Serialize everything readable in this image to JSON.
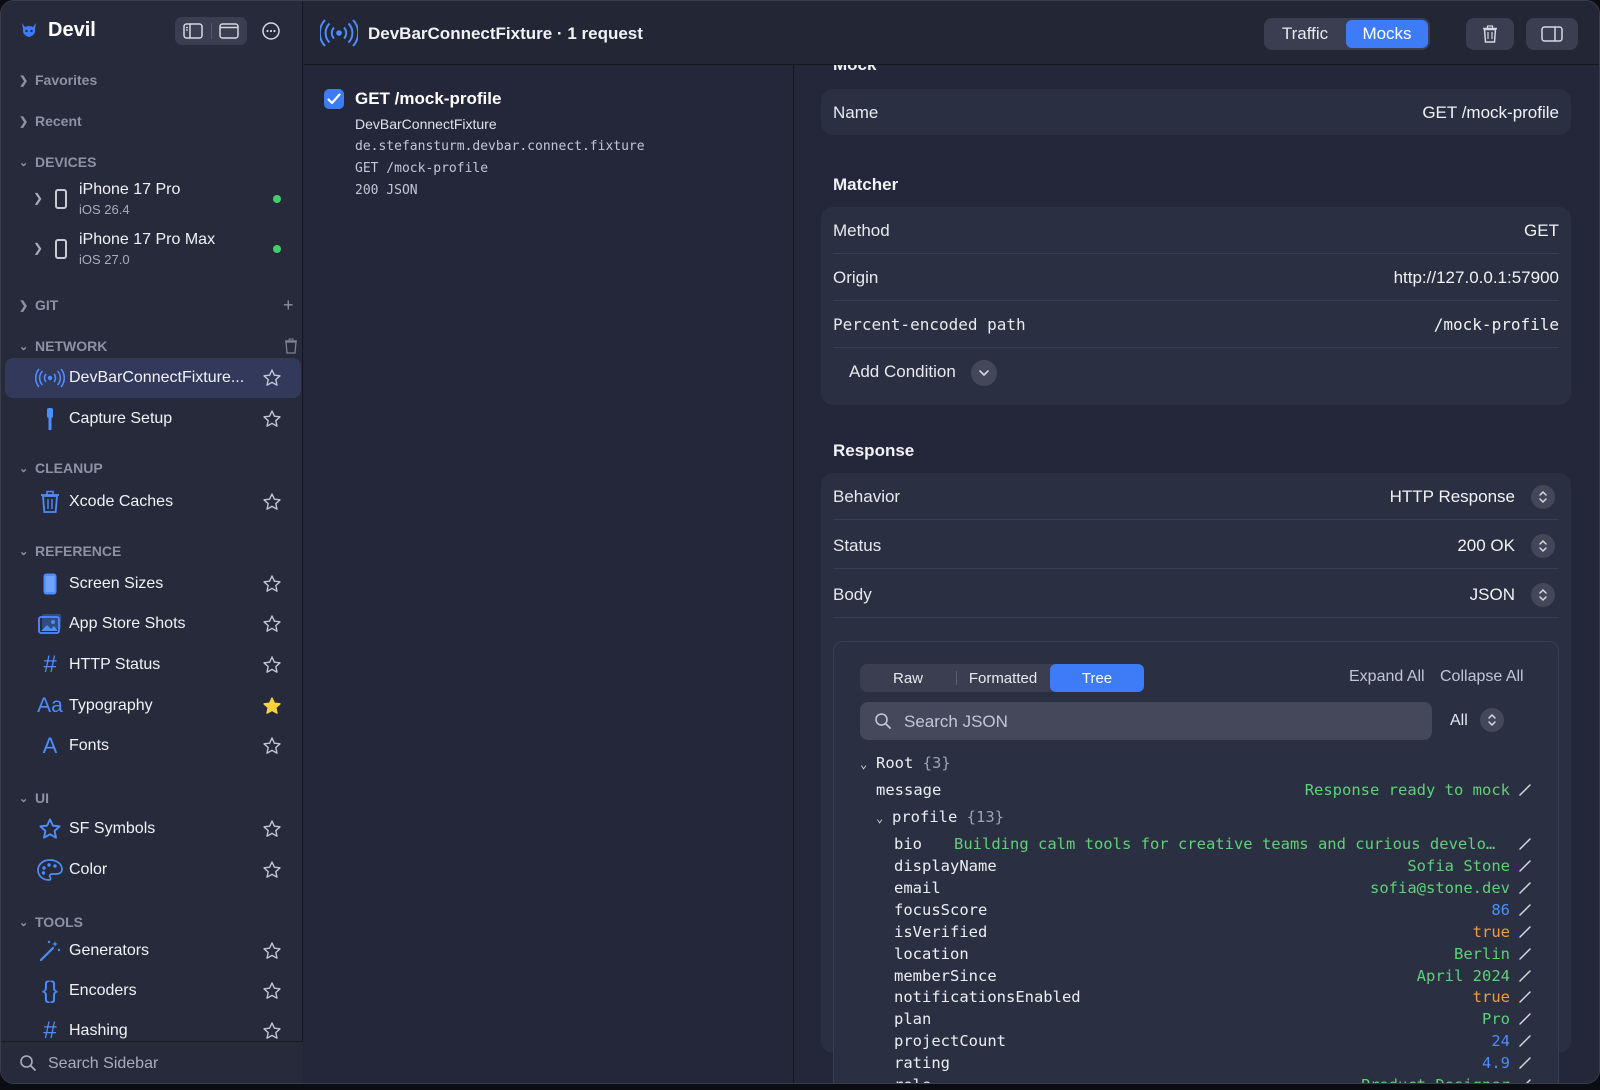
{
  "app": {
    "name": "Devil"
  },
  "sidebar": {
    "sections": {
      "favorites": "Favorites",
      "recent": "Recent",
      "devices": "DEVICES",
      "git": "GIT",
      "network": "NETWORK",
      "cleanup": "CLEANUP",
      "reference": "REFERENCE",
      "ui": "UI",
      "tools": "TOOLS"
    },
    "devices": [
      {
        "name": "iPhone 17 Pro",
        "os": "iOS 26.4",
        "status_color": "#3fd06b"
      },
      {
        "name": "iPhone 17 Pro Max",
        "os": "iOS 27.0",
        "status_color": "#3fd06b"
      }
    ],
    "network_items": [
      {
        "label": "DevBarConnectFixture...",
        "icon": "broadcast-icon",
        "selected": true
      },
      {
        "label": "Capture Setup",
        "icon": "capture-icon"
      }
    ],
    "cleanup_items": [
      {
        "label": "Xcode Caches",
        "icon": "trash-icon"
      }
    ],
    "reference_items": [
      {
        "label": "Screen Sizes",
        "icon": "phone-icon"
      },
      {
        "label": "App Store Shots",
        "icon": "photo-icon"
      },
      {
        "label": "HTTP Status",
        "icon": "hash-icon"
      },
      {
        "label": "Typography",
        "icon": "typography-icon",
        "favorite": true
      },
      {
        "label": "Fonts",
        "icon": "font-icon"
      }
    ],
    "ui_items": [
      {
        "label": "SF Symbols",
        "icon": "star-outline-icon"
      },
      {
        "label": "Color",
        "icon": "palette-icon"
      }
    ],
    "tools_items": [
      {
        "label": "Generators",
        "icon": "magic-wand-icon"
      },
      {
        "label": "Encoders",
        "icon": "braces-icon"
      },
      {
        "label": "Hashing",
        "icon": "hash-icon"
      }
    ],
    "search_placeholder": "Search Sidebar"
  },
  "header": {
    "title": "DevBarConnectFixture · 1 request",
    "tabs": [
      "Traffic",
      "Mocks"
    ],
    "active_tab": "Mocks",
    "accent": "#3d7bf7"
  },
  "request": {
    "title": "GET /mock-profile",
    "app": "DevBarConnectFixture",
    "bundle": "de.stefansturm.devbar.connect.fixture",
    "path": "GET /mock-profile",
    "status": "200 JSON",
    "checked": true
  },
  "detail": {
    "mock_section": "Mock",
    "name_label": "Name",
    "name_value": "GET /mock-profile",
    "matcher_section": "Matcher",
    "matcher_rows": [
      {
        "key": "Method",
        "value": "GET"
      },
      {
        "key": "Origin",
        "value": "http://127.0.0.1:57900"
      },
      {
        "key": "Percent-encoded path",
        "value": "/mock-profile"
      }
    ],
    "add_condition": "Add Condition",
    "response_section": "Response",
    "response_rows": [
      {
        "key": "Behavior",
        "value": "HTTP Response"
      },
      {
        "key": "Status",
        "value": "200 OK"
      },
      {
        "key": "Body",
        "value": "JSON"
      }
    ]
  },
  "json_viewer": {
    "modes": [
      "Raw",
      "Formatted",
      "Tree"
    ],
    "active_mode": "Tree",
    "expand_all": "Expand All",
    "collapse_all": "Collapse All",
    "search_placeholder": "Search JSON",
    "filter": "All",
    "root": {
      "key": "Root",
      "count": "{3}"
    },
    "message": {
      "key": "message",
      "value": "Response ready to mock"
    },
    "profile": {
      "key": "profile",
      "count": "{13}"
    },
    "bio": {
      "key": "bio",
      "value": "Building calm tools for creative teams and curious develo…"
    },
    "fields": [
      {
        "key": "displayName",
        "value": "Sofia Stone",
        "type": "str"
      },
      {
        "key": "email",
        "value": "sofia@stone.dev",
        "type": "str"
      },
      {
        "key": "focusScore",
        "value": "86",
        "type": "num"
      },
      {
        "key": "isVerified",
        "value": "true",
        "type": "bool"
      },
      {
        "key": "location",
        "value": "Berlin",
        "type": "str"
      },
      {
        "key": "memberSince",
        "value": "April 2024",
        "type": "str"
      },
      {
        "key": "notificationsEnabled",
        "value": "true",
        "type": "bool"
      },
      {
        "key": "plan",
        "value": "Pro",
        "type": "str"
      },
      {
        "key": "projectCount",
        "value": "24",
        "type": "num"
      },
      {
        "key": "rating",
        "value": "4.9",
        "type": "num"
      },
      {
        "key": "role",
        "value": "Product Designer",
        "type": "str"
      }
    ]
  }
}
